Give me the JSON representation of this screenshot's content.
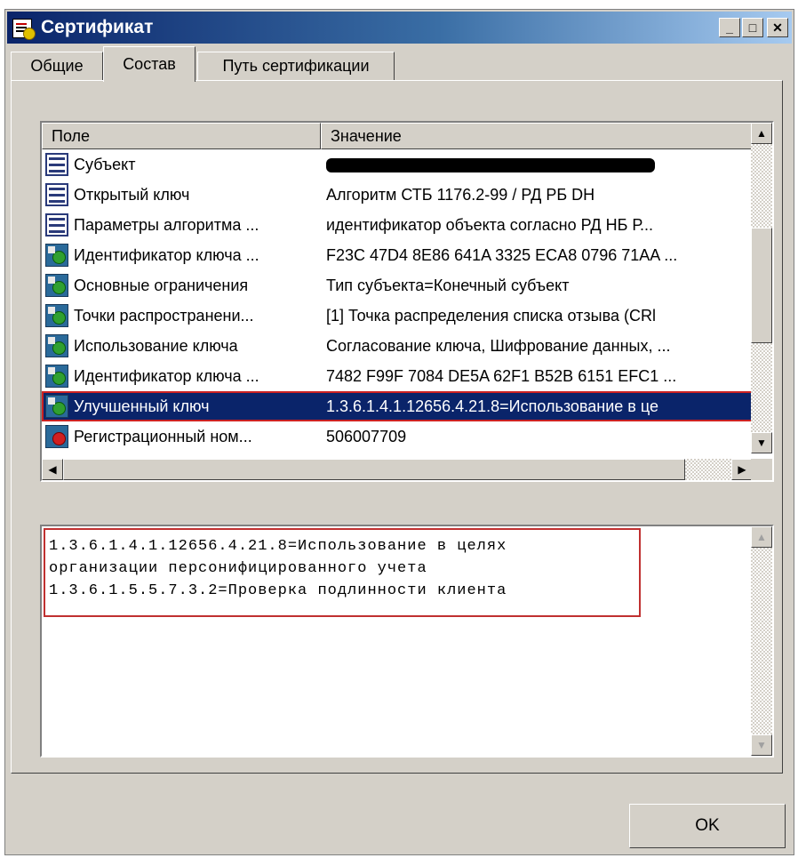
{
  "window": {
    "title": "Сертификат",
    "min_glyph": "_",
    "max_glyph": "□",
    "close_glyph": "✕"
  },
  "tabs": [
    {
      "label": "Общие",
      "active": false
    },
    {
      "label": "Состав",
      "active": true
    },
    {
      "label": "Путь сертификации",
      "active": false
    }
  ],
  "list": {
    "columns": [
      "Поле",
      "Значение"
    ],
    "rows": [
      {
        "field": "Субъект",
        "value": "",
        "icon": "document-icon",
        "redacted": true
      },
      {
        "field": "Открытый ключ",
        "value": "Алгоритм СТБ 1176.2-99 / РД РБ DH",
        "icon": "document-icon"
      },
      {
        "field": "Параметры алгоритма ...",
        "value": "идентификатор объекта  согласно РД НБ Р...",
        "icon": "document-icon"
      },
      {
        "field": "Идентификатор ключа ...",
        "value": "F23C 47D4 8E86 641A 3325 ECA8 0796 71AA ...",
        "icon": "extension-icon"
      },
      {
        "field": "Основные ограничения",
        "value": "Тип субъекта=Конечный субъект",
        "icon": "extension-icon"
      },
      {
        "field": "Точки распространени...",
        "value": "[1] Точка распределения списка отзыва (CRl",
        "icon": "extension-icon"
      },
      {
        "field": "Использование ключа",
        "value": "Согласование ключа, Шифрование данных, ...",
        "icon": "extension-icon"
      },
      {
        "field": "Идентификатор ключа ...",
        "value": "7482 F99F 7084 DE5A 62F1 B52B 6151 EFC1 ...",
        "icon": "extension-icon"
      },
      {
        "field": "Улучшенный ключ",
        "value": "1.3.6.1.4.1.12656.4.21.8=Использование в це",
        "icon": "extension-icon",
        "selected": true
      },
      {
        "field": "Регистрационный ном...",
        "value": "506007709",
        "icon": "critical-extension-icon"
      }
    ]
  },
  "details": {
    "lines": [
      "1.3.6.1.4.1.12656.4.21.8=Использование в целях",
      "организации персонифицированного учета",
      "1.3.6.1.5.5.7.3.2=Проверка подлинности клиента"
    ]
  },
  "scroll_glyphs": {
    "up": "▲",
    "down": "▼",
    "left": "◀",
    "right": "▶"
  },
  "ok_label": "OK"
}
